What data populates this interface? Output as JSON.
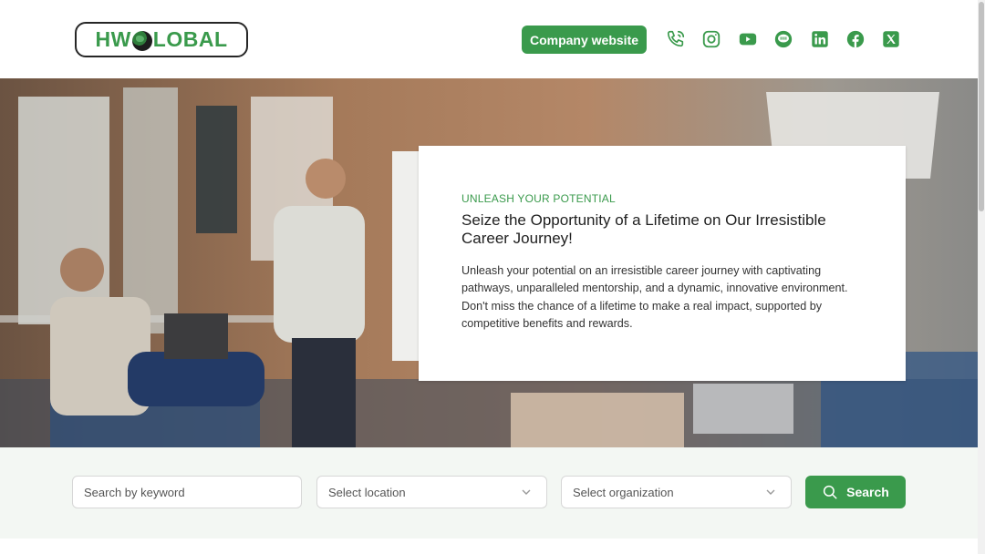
{
  "header": {
    "logo": {
      "text_left": "HW",
      "text_right": "LOBAL",
      "icon": "globe-icon"
    },
    "company_button": "Company website",
    "socials": [
      {
        "name": "phone-icon"
      },
      {
        "name": "instagram-icon"
      },
      {
        "name": "youtube-icon"
      },
      {
        "name": "line-icon"
      },
      {
        "name": "linkedin-icon"
      },
      {
        "name": "facebook-icon"
      },
      {
        "name": "x-twitter-icon"
      }
    ]
  },
  "hero": {
    "eyebrow": "UNLEASH YOUR POTENTIAL",
    "title": "Seize the Opportunity of a Lifetime on Our Irresistible Career Journey!",
    "body": "Unleash your potential on an irresistible career journey with captivating pathways, unparalleled mentorship, and a dynamic, innovative environment. Don't miss the chance of a lifetime to make a real impact, supported by competitive benefits and rewards."
  },
  "search": {
    "keyword_placeholder": "Search by keyword",
    "location_placeholder": "Select location",
    "organization_placeholder": "Select organization",
    "button_label": "Search"
  },
  "colors": {
    "brand_green": "#3a9a4c",
    "band_background": "#f3f7f3"
  }
}
